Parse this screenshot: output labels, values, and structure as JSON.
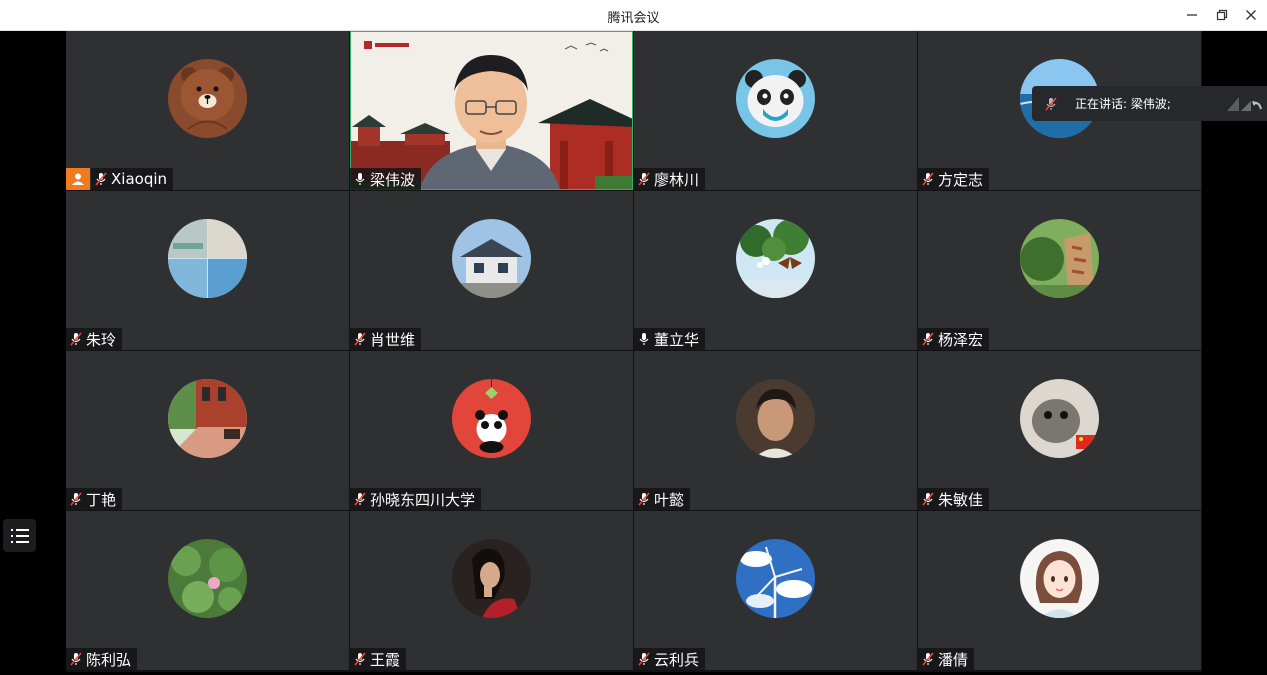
{
  "window": {
    "title": "腾讯会议"
  },
  "speaking": {
    "label": "正在讲话: 梁伟波;"
  },
  "tiles": [
    {
      "name": "Xiaoqin",
      "mic": "muted",
      "host": true
    },
    {
      "name": "梁伟波",
      "mic": "on",
      "video": true
    },
    {
      "name": "廖林川",
      "mic": "muted"
    },
    {
      "name": "方定志",
      "mic": "muted"
    },
    {
      "name": "朱玲",
      "mic": "muted"
    },
    {
      "name": "肖世维",
      "mic": "muted"
    },
    {
      "name": "董立华",
      "mic": "on"
    },
    {
      "name": "杨泽宏",
      "mic": "muted"
    },
    {
      "name": "丁艳",
      "mic": "muted"
    },
    {
      "name": "孙晓东四川大学",
      "mic": "muted"
    },
    {
      "name": "叶懿",
      "mic": "muted"
    },
    {
      "name": "朱敏佳",
      "mic": "muted"
    },
    {
      "name": "陈利弘",
      "mic": "muted"
    },
    {
      "name": "王霞",
      "mic": "muted"
    },
    {
      "name": "云利兵",
      "mic": "muted"
    },
    {
      "name": "潘倩",
      "mic": "muted"
    }
  ],
  "colors": {
    "titlebar": "#ffffff",
    "tile": "#2e3032",
    "host_badge": "#f07a1e",
    "active_border": "#2fb36b"
  }
}
